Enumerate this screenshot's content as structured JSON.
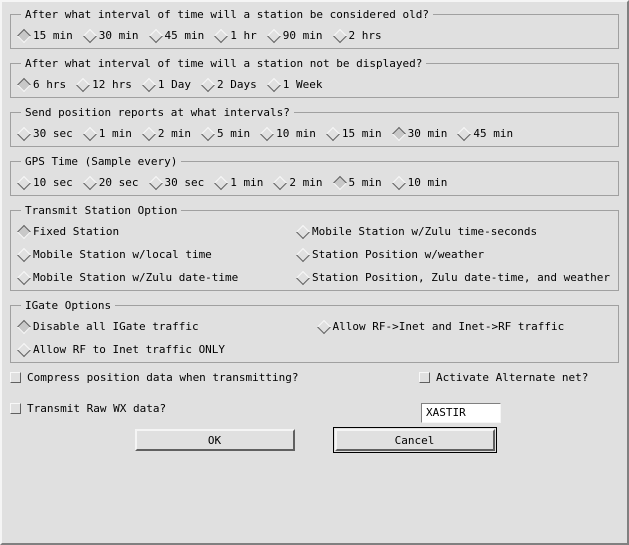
{
  "groups": {
    "old_station": {
      "legend": "After what interval of time will a station be considered old?",
      "options": [
        "15 min",
        "30 min",
        "45 min",
        "1 hr",
        "90 min",
        "2 hrs"
      ],
      "selected": 0
    },
    "not_displayed": {
      "legend": "After what interval of time will a station not be displayed?",
      "options": [
        "6 hrs",
        "12 hrs",
        "1 Day",
        "2 Days",
        "1 Week"
      ],
      "selected": 0
    },
    "posit_interval": {
      "legend": "Send position reports at what intervals?",
      "options": [
        "30 sec",
        "1 min",
        "2 min",
        "5 min",
        "10 min",
        "15 min",
        "30 min",
        "45 min"
      ],
      "selected": 6
    },
    "gps_time": {
      "legend": "GPS Time (Sample every)",
      "options": [
        "10 sec",
        "20 sec",
        "30 sec",
        "1 min",
        "2 min",
        "5 min",
        "10 min"
      ],
      "selected": 5
    },
    "transmit_option": {
      "legend": "Transmit Station Option",
      "options": [
        "Fixed Station",
        "Mobile Station w/Zulu time-seconds",
        "Mobile Station w/local time",
        "Station Position w/weather",
        "Mobile Station w/Zulu date-time",
        "Station Position, Zulu date-time, and weather"
      ],
      "selected": 0
    },
    "igate": {
      "legend": "IGate Options",
      "options": [
        "Disable all IGate traffic",
        "Allow RF->Inet and Inet->RF traffic",
        "Allow RF to Inet traffic ONLY"
      ],
      "selected": 0
    }
  },
  "checks": {
    "compress": "Compress position data when transmitting?",
    "altnet": "Activate Alternate net?",
    "raw_wx": "Transmit Raw WX data?"
  },
  "altnet_value": "XASTIR",
  "buttons": {
    "ok": "OK",
    "cancel": "Cancel"
  }
}
